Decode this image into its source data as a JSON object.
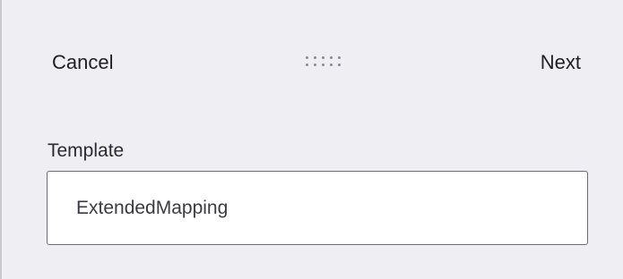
{
  "header": {
    "cancel_label": "Cancel",
    "next_label": "Next",
    "drag_icon": "drag-handle-dots"
  },
  "form": {
    "template_label": "Template",
    "template_value": "ExtendedMapping"
  },
  "colors": {
    "panel_background": "#efeff3",
    "input_background": "#ffffff",
    "text": "#1f1f24"
  }
}
